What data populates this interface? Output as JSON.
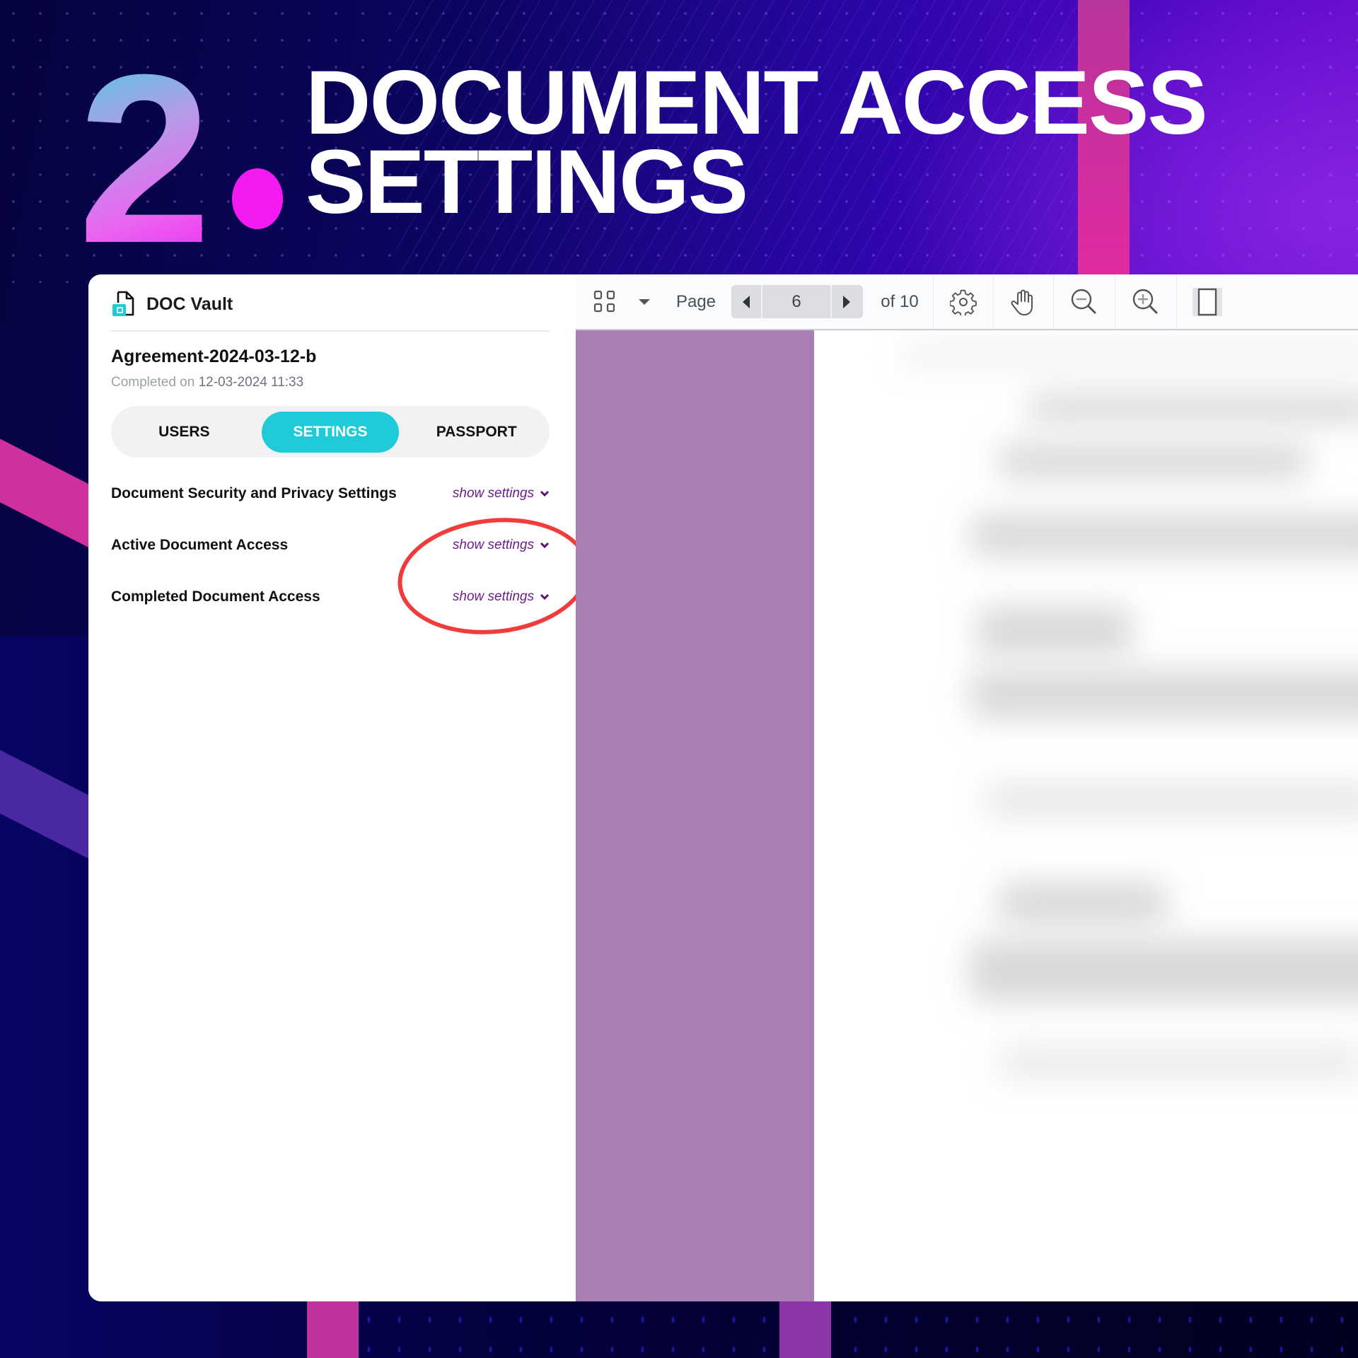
{
  "headline": {
    "number": "2",
    "line1": "DOCUMENT ACCESS",
    "line2": "SETTINGS"
  },
  "app": {
    "brand_name": "DOC Vault",
    "brand_icon": "document-vault-icon",
    "document": {
      "title": "Agreement-2024-03-12-b",
      "completed_prefix": "Completed on",
      "completed_date": "12-03-2024 11:33"
    },
    "tabs": [
      {
        "label": "USERS",
        "active": false
      },
      {
        "label": "SETTINGS",
        "active": true
      },
      {
        "label": "PASSPORT",
        "active": false
      }
    ],
    "settings_sections": [
      {
        "label": "Document Security and Privacy Settings",
        "action": "show settings",
        "icon": "chevron-down-icon"
      },
      {
        "label": "Active Document Access",
        "action": "show settings",
        "icon": "chevron-down-icon"
      },
      {
        "label": "Completed Document Access",
        "action": "show settings",
        "icon": "chevron-down-icon"
      }
    ],
    "annotation": {
      "type": "red-ellipse-highlight",
      "target": "show settings links (Active and Completed Document Access)"
    }
  },
  "toolbar": {
    "thumbnails_icon": "grid-icon",
    "dropdown_icon": "caret-down-icon",
    "page_label": "Page",
    "prev_icon": "triangle-left-icon",
    "current_page": "6",
    "next_icon": "triangle-right-icon",
    "total_label": "of 10",
    "settings_icon": "gear-icon",
    "pan_icon": "hand-icon",
    "zoom_out_icon": "zoom-out-icon",
    "zoom_in_icon": "zoom-in-icon",
    "page_view_icon": "single-page-icon"
  },
  "colors": {
    "accent_tab": "#1fcad9",
    "link": "#6a1e88",
    "annotation": "#f23c3c",
    "viewer_strip": "#a87eb5"
  }
}
